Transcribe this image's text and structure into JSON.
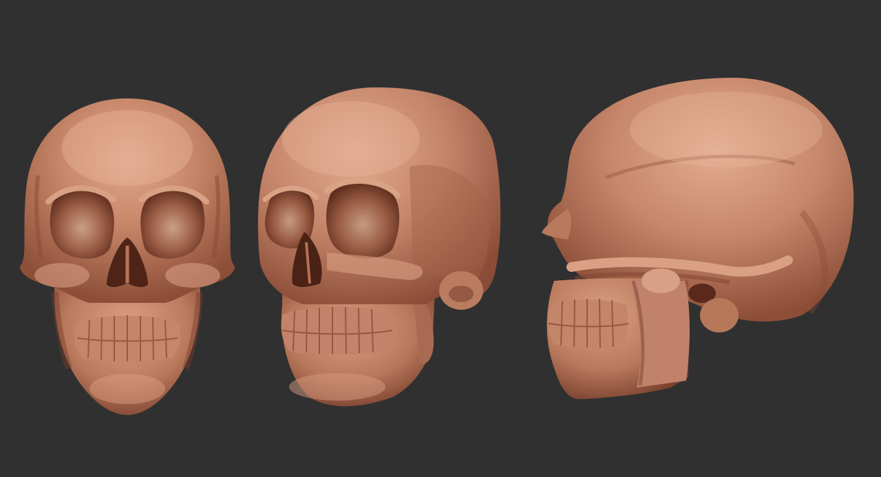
{
  "scene": {
    "background_color": "#303030",
    "material_colors": {
      "base": "#b9765a",
      "highlight": "#e0a588",
      "mid": "#c28367",
      "shadow": "#6b3424",
      "deep_shadow": "#4a2216"
    },
    "views": [
      {
        "name": "front-view",
        "icon": "skull-front"
      },
      {
        "name": "three-quarter-view",
        "icon": "skull-three-quarter"
      },
      {
        "name": "side-view",
        "icon": "skull-profile"
      }
    ]
  }
}
